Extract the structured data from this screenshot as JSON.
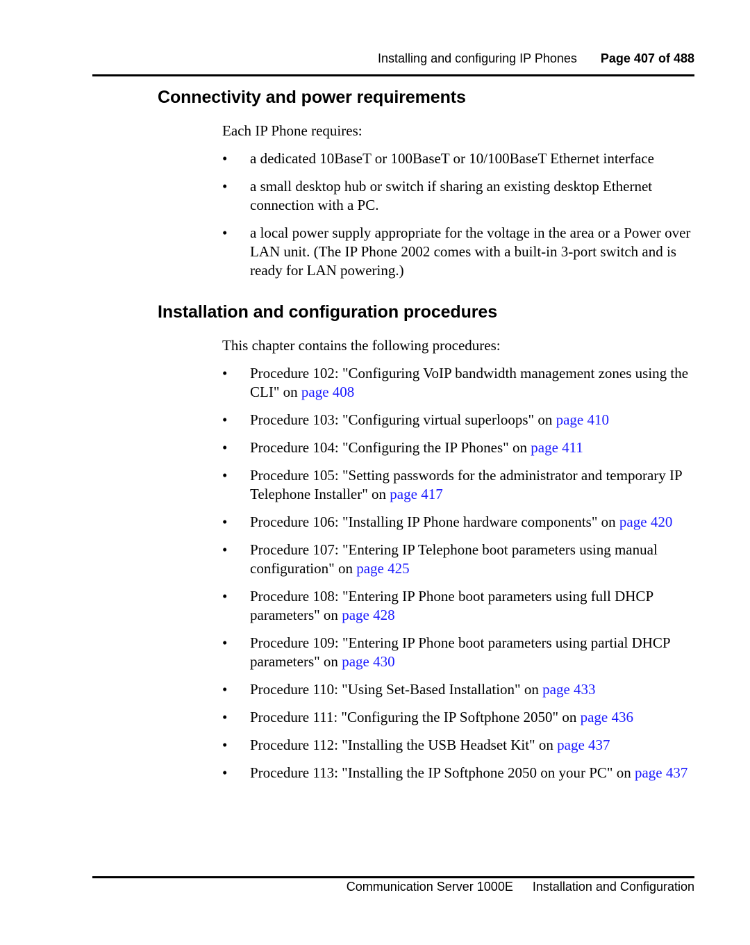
{
  "header": {
    "section_title": "Installing and configuring IP Phones",
    "page_label": "Page 407 of 488"
  },
  "footer": {
    "product": "Communication Server 1000E",
    "doc_title": "Installation and Configuration"
  },
  "colors": {
    "link": "#1a1aff",
    "text": "#000000"
  },
  "connectivity": {
    "heading": "Connectivity and power requirements",
    "intro": "Each IP Phone requires:",
    "items": [
      "a dedicated 10BaseT or 100BaseT or 10/100BaseT Ethernet interface",
      "a small desktop hub or switch if sharing an existing desktop Ethernet connection with a PC.",
      "a local power supply appropriate for the voltage in the area or a Power over LAN unit. (The IP Phone 2002 comes with a built-in 3-port switch and is ready for LAN powering.)"
    ]
  },
  "installation": {
    "heading": "Installation and configuration procedures",
    "intro": "This chapter contains the following procedures:",
    "procedures": [
      {
        "text": "Procedure 102: \"Configuring VoIP bandwidth management zones using the CLI\" on ",
        "link": "page 408"
      },
      {
        "text": "Procedure 103: \"Configuring virtual superloops\" on ",
        "link": "page 410"
      },
      {
        "text": "Procedure 104: \"Configuring the IP Phones\" on ",
        "link": "page 411"
      },
      {
        "text": "Procedure 105: \"Setting passwords for the administrator and temporary IP Telephone Installer\" on ",
        "link": "page 417"
      },
      {
        "text": "Procedure 106: \"Installing IP Phone hardware components\" on ",
        "link": "page 420"
      },
      {
        "text": "Procedure 107: \"Entering IP Telephone boot parameters using manual configuration\" on ",
        "link": "page 425"
      },
      {
        "text": "Procedure 108: \"Entering IP Phone boot parameters using full DHCP parameters\" on ",
        "link": "page 428"
      },
      {
        "text": "Procedure 109: \"Entering IP Phone boot parameters using partial DHCP parameters\" on ",
        "link": "page 430"
      },
      {
        "text": "Procedure 110: \"Using Set-Based Installation\" on ",
        "link": "page 433"
      },
      {
        "text": "Procedure 111: \"Configuring the IP Softphone 2050\" on ",
        "link": "page 436"
      },
      {
        "text": "Procedure 112: \"Installing the USB Headset Kit\" on ",
        "link": "page 437"
      },
      {
        "text": "Procedure 113: \"Installing the IP Softphone 2050 on your PC\" on ",
        "link": "page 437"
      }
    ]
  },
  "bullet_glyph": "•"
}
